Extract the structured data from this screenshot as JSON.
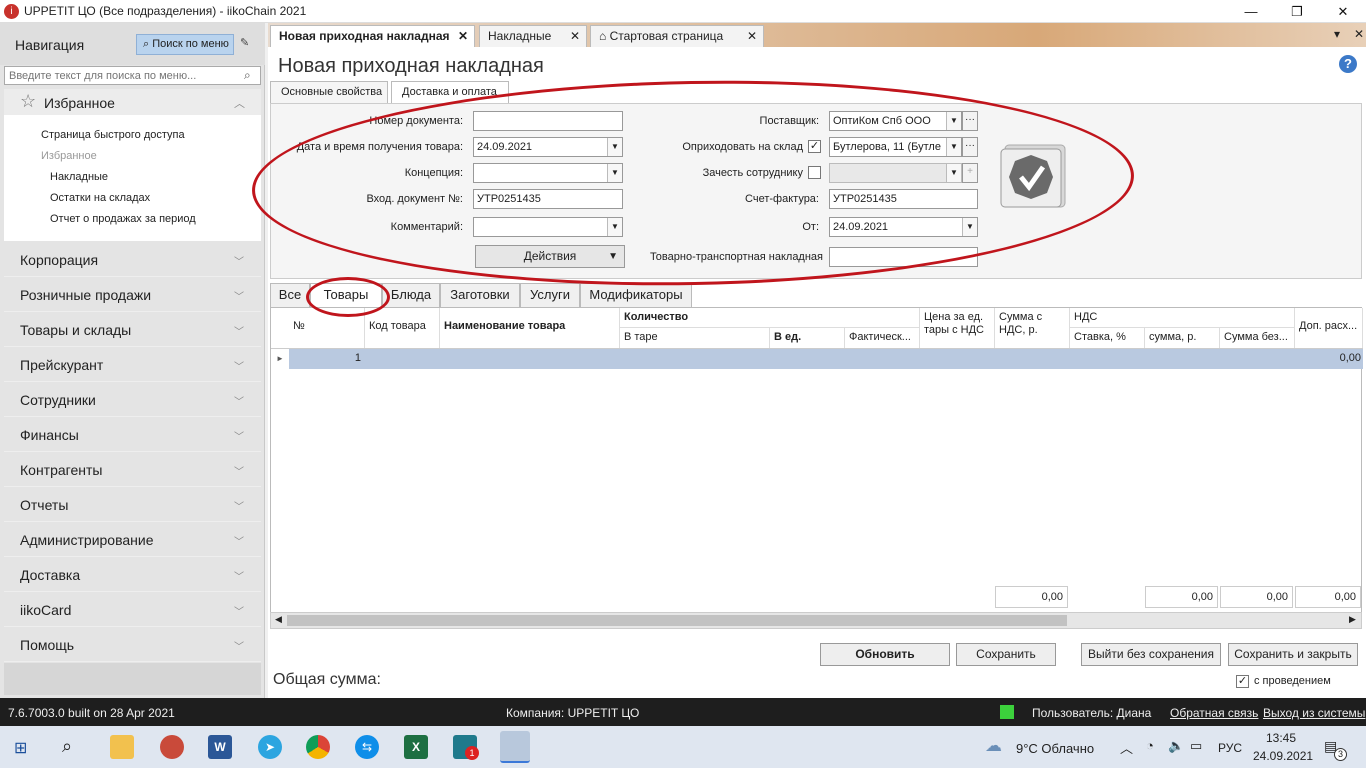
{
  "window": {
    "title": "UPPETIT ЦО (Все подразделения)  - iikoChain 2021",
    "minimize": "—",
    "maximize": "❐",
    "close": "✕"
  },
  "nav": {
    "title": "Навигация",
    "search_button": "Поиск по меню",
    "search_placeholder": "Введите текст для поиска по меню...",
    "favorites": {
      "title": "Избранное",
      "items": [
        "Страница быстрого доступа",
        "Избранное",
        "Накладные",
        "Остатки на складах",
        "Отчет о продажах за период"
      ]
    },
    "sections": [
      "Корпорация",
      "Розничные продажи",
      "Товары и склады",
      "Прейскурант",
      "Сотрудники",
      "Финансы",
      "Контрагенты",
      "Отчеты",
      "Администрирование",
      "Доставка",
      "iikoCard",
      "Помощь"
    ]
  },
  "tabs": [
    {
      "label": "Новая приходная накладная",
      "close": "✕"
    },
    {
      "label": "Накладные",
      "close": "✕"
    },
    {
      "label": "Стартовая страница",
      "close": "✕"
    }
  ],
  "tabs_menu_icon": "▾",
  "page": {
    "title": "Новая приходная накладная",
    "prop_tabs": [
      "Основные свойства",
      "Доставка и оплата"
    ],
    "fields": {
      "doc_number_label": "Номер документа:",
      "doc_number": "",
      "date_label": "Дата и время получения товара:",
      "date": "24.09.2021",
      "concept_label": "Концепция:",
      "concept": "",
      "incoming_doc_label": "Вход. документ №:",
      "incoming_doc": "УТР0251435",
      "comment_label": "Комментарий:",
      "comment": "",
      "supplier_label": "Поставщик:",
      "supplier": "ОптиКом Спб ООО",
      "warehouse_label": "Оприходовать на склад",
      "warehouse": "Бутлерова, 11 (Бутле",
      "employee_label": "Зачесть сотруднику",
      "employee": "",
      "invoice_label": "Счет-фактура:",
      "invoice": "УТР0251435",
      "from_label": "От:",
      "from": "24.09.2021",
      "ttn_label": "Товарно-транспортная накладная",
      "ttn": ""
    },
    "actions_button": "Действия",
    "grid_tabs": [
      "Все",
      "Товары",
      "Блюда",
      "Заготовки",
      "Услуги",
      "Модификаторы"
    ],
    "grid": {
      "headers": {
        "num": "№",
        "code": "Код товара",
        "name": "Наименование товара",
        "qty": "Количество",
        "in_pack": "В таре",
        "in_unit": "В ед.",
        "actual": "Фактическ...",
        "price": "Цена за ед. тары с НДС",
        "sum_vat": "Сумма с НДС, р.",
        "vat": "НДС",
        "rate": "Ставка, %",
        "vat_sum": "сумма, р.",
        "sum_novat": "Сумма без...",
        "extra": "Доп. расх..."
      },
      "rows": [
        {
          "num": "1",
          "extra": "0,00"
        }
      ],
      "totals": {
        "sum_vat": "0,00",
        "vat_sum": "0,00",
        "sum_novat": "0,00",
        "extra": "0,00"
      }
    },
    "buttons": {
      "refresh": "Обновить",
      "save": "Сохранить",
      "exit": "Выйти без сохранения",
      "save_close": "Сохранить и закрыть"
    },
    "total_label": "Общая сумма:",
    "posted_label": "с проведением"
  },
  "status": {
    "version": "7.6.7003.0 built on 28 Apr 2021",
    "company": "Компания: UPPETIT ЦО",
    "user": "Пользователь: Диана",
    "feedback": "Обратная связь",
    "logout": "Выход из системы"
  },
  "taskbar": {
    "weather": "9°C  Облачно",
    "lang": "РУС",
    "time": "13:45",
    "date": "24.09.2021",
    "notif_count": "3",
    "badge": "1"
  }
}
